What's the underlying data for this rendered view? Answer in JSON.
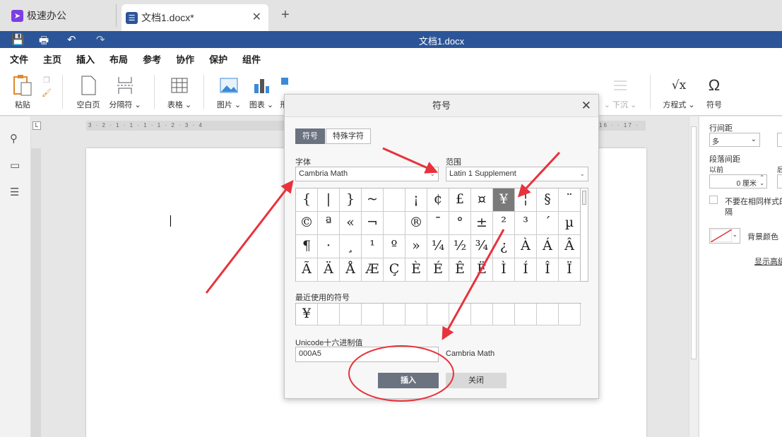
{
  "tabs": [
    {
      "label": "极速办公",
      "icon": "rocket-icon",
      "color": "#7b3fe4"
    },
    {
      "label": "文档1.docx*",
      "icon": "document-icon",
      "color": "#2b5598"
    }
  ],
  "titlebar": {
    "title": "文档1.docx"
  },
  "menu": [
    "文件",
    "主页",
    "插入",
    "布局",
    "参考",
    "协作",
    "保护",
    "组件"
  ],
  "ribbon": {
    "paste": "粘贴",
    "blank_page": "空白页",
    "page_break": "分隔符",
    "table": "表格",
    "picture": "图片",
    "chart": "图表",
    "shape_partial": "形",
    "textart_partial": "下沉",
    "equation": "方程式",
    "symbol": "符号"
  },
  "ruler": {
    "left_marks": "3 · 2 · 1 · 1 · 1 · 1 · 2 · 3 · 4",
    "right_marks": "16 · · 17 ·"
  },
  "right_panel": {
    "line_spacing_label": "行间距",
    "line_spacing_value": "多",
    "para_spacing_label": "段落间距",
    "before_label": "以前",
    "after_label_partial": "后",
    "before_value": "0 厘米",
    "no_space_label": "不要在相同样式的",
    "no_space_label2": "隔",
    "bg_color_label": "背景颜色",
    "show_advanced": "显示高级"
  },
  "dialog": {
    "title": "符号",
    "tab_symbol": "符号",
    "tab_special": "特殊字符",
    "font_label": "字体",
    "font_value": "Cambria Math",
    "range_label": "范围",
    "range_value": "Latin 1 Supplement",
    "symbols": [
      [
        "{",
        "|",
        "}",
        "~",
        " ",
        "¡",
        "¢",
        "£",
        "¤",
        "¥",
        "¦",
        "§",
        "¨"
      ],
      [
        "©",
        "ª",
        "«",
        "¬",
        " ",
        "®",
        "¯",
        "°",
        "±",
        "²",
        "³",
        "´",
        "µ"
      ],
      [
        "¶",
        "·",
        "¸",
        "¹",
        "º",
        "»",
        "¼",
        "½",
        "¾",
        "¿",
        "À",
        "Á",
        "Â"
      ],
      [
        "Ã",
        "Ä",
        "Å",
        "Æ",
        "Ç",
        "È",
        "É",
        "Ê",
        "Ë",
        "Ì",
        "Í",
        "Î",
        "Ï"
      ]
    ],
    "selected_symbol": "¥",
    "recent_label": "最近使用的符号",
    "recent_symbols": [
      "¥"
    ],
    "unicode_label": "Unicode十六进制值",
    "unicode_value": "000A5",
    "unicode_font": "Cambria Math",
    "insert_button": "插入",
    "close_button": "关闭"
  },
  "colors": {
    "accent": "#2b5598",
    "annotation": "#e8323c",
    "selected_cell": "#7a7a7a"
  }
}
